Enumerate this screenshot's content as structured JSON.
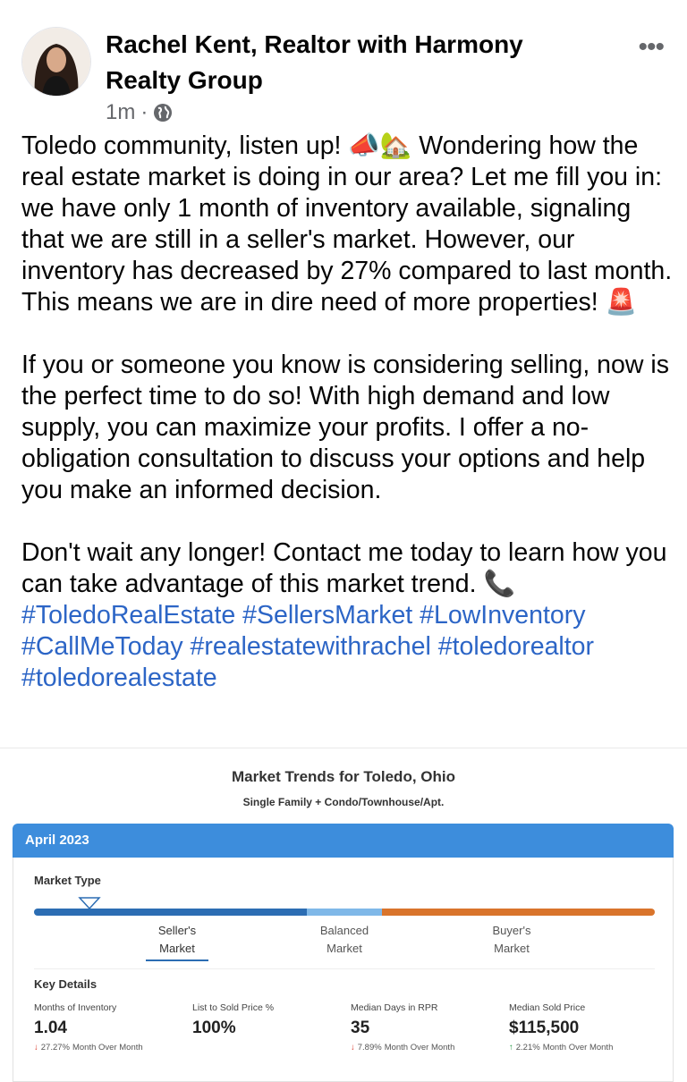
{
  "post": {
    "author": "Rachel Kent, Realtor with Harmony Realty Group",
    "time": "1m",
    "privacy_icon": "globe-icon",
    "more_icon": "more-options-icon",
    "paragraph1": "Toledo community, listen up! 📣🏡 Wondering how the real estate market is doing in our area? Let me fill you in: we have only 1 month of inventory available, signaling that we are still in a seller's market. However, our inventory has decreased by 27% compared to last month. This means we are in dire need of more properties! 🚨",
    "paragraph2": "If you or someone you know is considering selling, now is the perfect time to do so! With high demand and low supply, you can maximize your profits. I offer a no-obligation consultation to discuss your options and help you make an informed decision.",
    "paragraph3": "Don't wait any longer! Contact me today to learn how you can take advantage of this market trend. 📞",
    "hashtags": "#ToledoRealEstate #SellersMarket #LowInventory #CallMeToday #realestatewithrachel #toledorealtor #toledorealestate"
  },
  "card": {
    "title": "Market Trends for Toledo, Ohio",
    "subtitle": "Single Family + Condo/Townhouse/Apt.",
    "month": "April 2023",
    "market_type_label": "Market Type",
    "market_types": {
      "seller": "Seller's Market",
      "balanced": "Balanced Market",
      "buyer": "Buyer's Market"
    },
    "key_details_label": "Key Details",
    "stats": [
      {
        "label": "Months of Inventory",
        "value": "1.04",
        "change": "27.27%",
        "change_note": "Month Over Month",
        "direction": "down"
      },
      {
        "label": "List to Sold Price %",
        "value": "100%"
      },
      {
        "label": "Median Days in RPR",
        "value": "35",
        "change": "7.89%",
        "change_note": "Month Over Month",
        "direction": "down"
      },
      {
        "label": "Median Sold Price",
        "value": "$115,500",
        "change": "2.21%",
        "change_note": "Month Over Month",
        "direction": "up"
      }
    ],
    "colors": {
      "seller": "#2c6db3",
      "balanced": "#7fb8e8",
      "buyer": "#d9742b",
      "header": "#3d8ddc"
    }
  }
}
